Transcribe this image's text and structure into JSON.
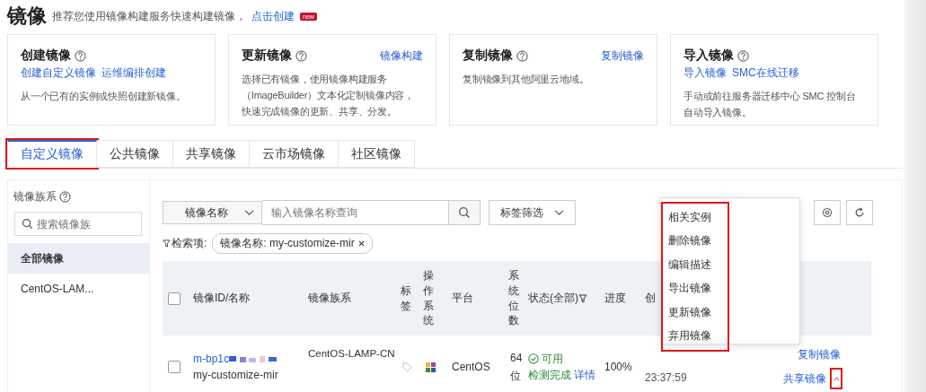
{
  "header": {
    "title": "镜像",
    "subtitle": "推荐您使用镜像构建服务快速构建镜像，",
    "link": "点击创建",
    "badge": "new"
  },
  "cards": [
    {
      "title": "创建镜像",
      "links": [
        "创建自定义镜像",
        "运维编排创建"
      ],
      "description": "从一个已有的实例或快照创建新镜像。"
    },
    {
      "title": "更新镜像",
      "corner_link": "镜像构建",
      "description": "选择已有镜像，使用镜像构建服务（ImageBuilder）文本化定制镜像内容，快速完成镜像的更新、共享、分发。"
    },
    {
      "title": "复制镜像",
      "corner_link": "复制镜像",
      "description": "复制镜像到其他阿里云地域。"
    },
    {
      "title": "导入镜像",
      "links": [
        "导入镜像",
        "SMC在线迁移"
      ],
      "description": "手动或前往服务器迁移中心 SMC 控制台自动导入镜像。"
    }
  ],
  "tabs": [
    {
      "label": "自定义镜像",
      "selected": true,
      "highlighted": true
    },
    {
      "label": "公共镜像",
      "selected": false,
      "highlighted": false
    },
    {
      "label": "共享镜像",
      "selected": false,
      "highlighted": false
    },
    {
      "label": "云市场镜像",
      "selected": false,
      "highlighted": false
    },
    {
      "label": "社区镜像",
      "selected": false,
      "highlighted": false
    }
  ],
  "sidebar": {
    "title": "镜像族系",
    "search_placeholder": "搜索镜像族",
    "items": [
      {
        "label": "全部镜像",
        "selected": true
      },
      {
        "label": "CentOS-LAM...",
        "selected": false
      }
    ]
  },
  "toolbar": {
    "select": "镜像名称",
    "search_placeholder": "输入镜像名称查询",
    "tag_filter": "标签筛选"
  },
  "filter": {
    "label": "检索项:",
    "chip": "镜像名称: my-customize-mir"
  },
  "table": {
    "select_all": {
      "checked": false
    },
    "columns": [
      "镜像ID/名称",
      "镜像族系",
      "标签",
      "操作系统",
      "平台",
      "系统位数",
      "状态(全部)",
      "进度",
      "创"
    ],
    "rows": [
      {
        "checked": false,
        "id": "m-bp1c",
        "name": "my-customize-mir",
        "family": "CentOS-LAMP-CN",
        "platform": "CentOS",
        "bits": "64位",
        "status": "可用",
        "check": "检测完成",
        "detail": "详情",
        "progress": "100%",
        "created": "23:37:59",
        "actions": [
          "复制镜像",
          "共享镜像"
        ],
        "more_highlighted": true
      }
    ]
  },
  "menu": {
    "highlighted": true,
    "items": [
      "相关实例",
      "删除镜像",
      "编辑描述",
      "导出镜像",
      "更新镜像",
      "弃用镜像"
    ]
  }
}
